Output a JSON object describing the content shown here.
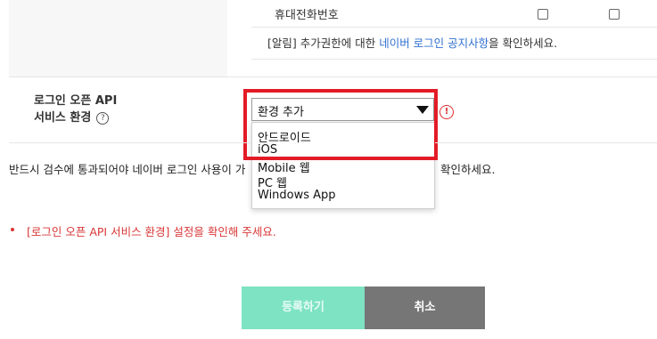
{
  "permissions": {
    "last_row_label": "휴대전화번호",
    "notice_prefix": "[알림] 추가권한에 대한 ",
    "notice_link": "네이버 로그인 공지사항",
    "notice_suffix": "을 확인하세요."
  },
  "service_env": {
    "label_line1": "로그인 오픈 API",
    "label_line2": "서비스 환경",
    "help_symbol": "?",
    "select_value": "환경 추가",
    "alert_symbol": "!",
    "options": [
      "안드로이드",
      "iOS",
      "Mobile 웹",
      "PC 웹",
      "Windows App"
    ]
  },
  "review_notice": {
    "left": "반드시 검수에 통과되어야 네이버 로그인 사용이 가",
    "right": "확인하세요."
  },
  "error_message": "[로그인 오픈 API 서비스 환경] 설정을 확인해 주세요.",
  "buttons": {
    "register": "등록하기",
    "cancel": "취소"
  },
  "colors": {
    "highlight": "#e21b26",
    "link": "#2f6fd1",
    "error": "#d93636",
    "register_button": "#7ee3c3",
    "cancel_button": "#767676"
  }
}
